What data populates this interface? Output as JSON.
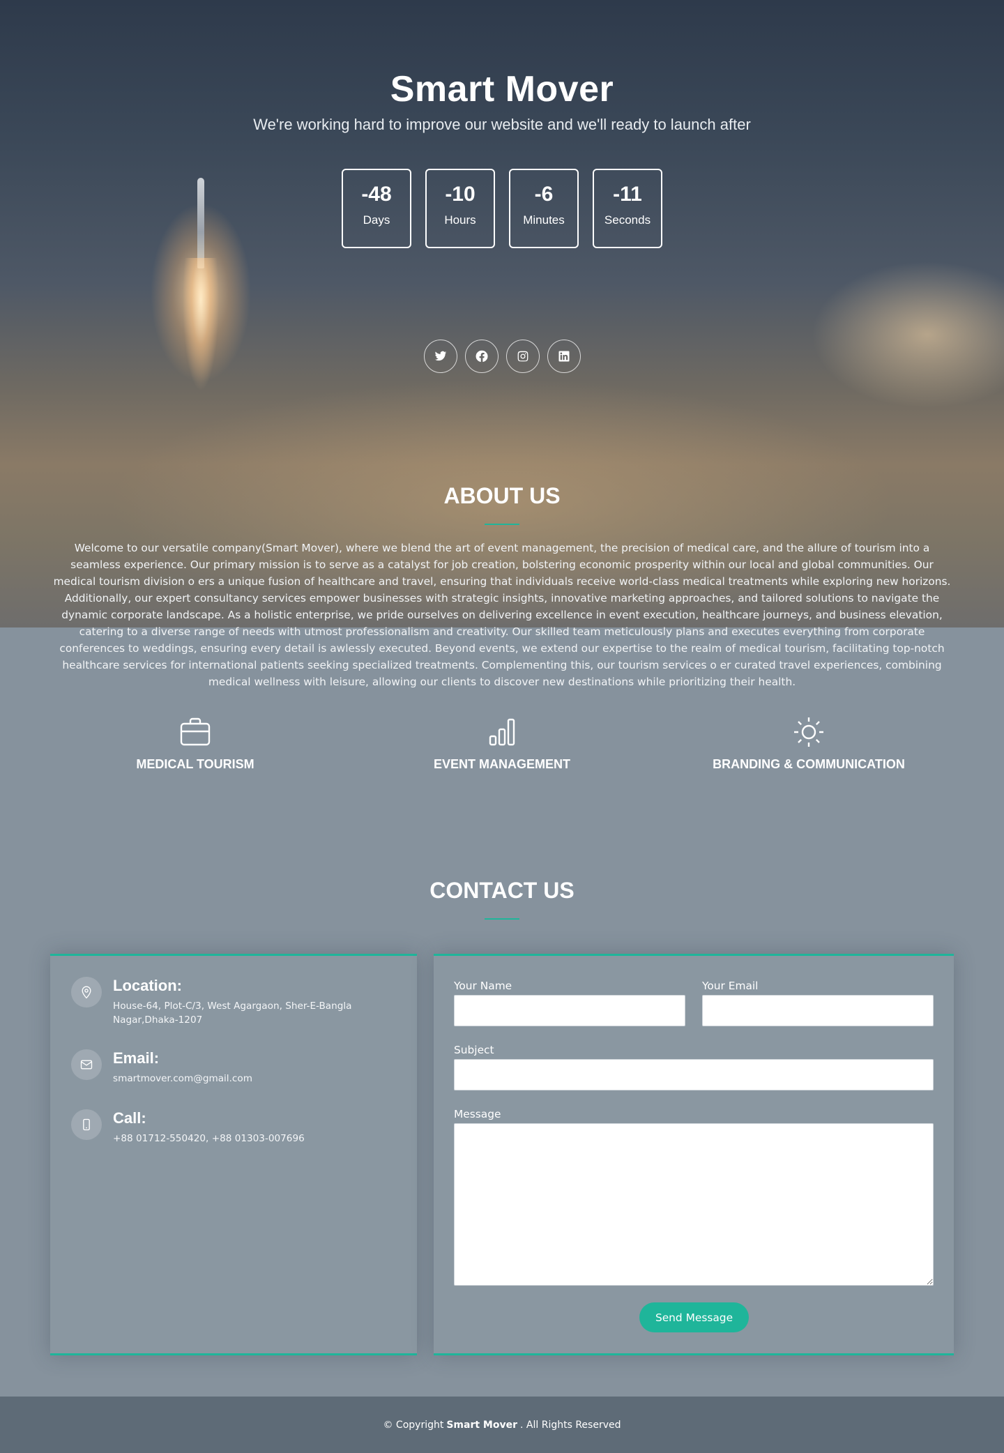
{
  "header": {
    "title": "Smart Mover",
    "tagline": "We're working hard to improve our website and we'll ready to launch after"
  },
  "countdown": [
    {
      "value": "-48",
      "label": "Days"
    },
    {
      "value": "-10",
      "label": "Hours"
    },
    {
      "value": "-6",
      "label": "Minutes"
    },
    {
      "value": "-11",
      "label": "Seconds"
    }
  ],
  "social": [
    {
      "icon": "twitter-icon"
    },
    {
      "icon": "facebook-icon"
    },
    {
      "icon": "instagram-icon"
    },
    {
      "icon": "linkedin-icon"
    }
  ],
  "about": {
    "title": "ABOUT US",
    "text": "Welcome to our versatile company(Smart Mover), where we blend the art of event management, the precision of medical care, and the allure of tourism into a seamless experience. Our primary mission is to serve as a catalyst for job creation, bolstering economic prosperity within our local and global communities. Our medical tourism division o ers a unique fusion of healthcare and travel, ensuring that individuals receive world-class medical treatments while exploring new horizons. Additionally, our expert consultancy services empower businesses with strategic insights, innovative marketing approaches, and tailored solutions to navigate the dynamic corporate landscape. As a holistic enterprise, we pride ourselves on delivering excellence in event execution, healthcare journeys, and business elevation, catering to a diverse range of needs with utmost professionalism and creativity. Our skilled team meticulously plans and executes everything from corporate conferences to weddings, ensuring every detail is awlessly executed. Beyond events, we extend our expertise to the realm of medical tourism, facilitating top-notch healthcare services for international patients seeking specialized treatments. Complementing this, our tourism services o er curated travel experiences, combining medical wellness with leisure, allowing our clients to discover new destinations while prioritizing their health."
  },
  "services": [
    {
      "icon": "briefcase-icon",
      "label": "MEDICAL TOURISM"
    },
    {
      "icon": "bar-chart-icon",
      "label": "EVENT MANAGEMENT"
    },
    {
      "icon": "sun-icon",
      "label": "BRANDING & COMMUNICATION"
    }
  ],
  "contact": {
    "title": "CONTACT US",
    "location": {
      "heading": "Location:",
      "text": "House-64, Plot-C/3, West Agargaon, Sher-E-Bangla Nagar,Dhaka-1207",
      "icon": "map-pin-icon"
    },
    "email": {
      "heading": "Email:",
      "text": "smartmover.com@gmail.com",
      "icon": "envelope-icon"
    },
    "call": {
      "heading": "Call:",
      "text": "+88 01712-550420, +88 01303-007696",
      "icon": "phone-icon"
    },
    "form": {
      "name_label": "Your Name",
      "name_value": "",
      "email_label": "Your Email",
      "email_value": "",
      "subject_label": "Subject",
      "subject_value": "",
      "message_label": "Message",
      "message_value": "",
      "send_label": "Send Message"
    }
  },
  "footer": {
    "prefix": "© Copyright",
    "brand": "Smart Mover",
    "suffix": ". All Rights Reserved"
  },
  "colors": {
    "accent": "#1fb59a",
    "page_background": "#86929d",
    "footer_background": "#5e6b77"
  }
}
